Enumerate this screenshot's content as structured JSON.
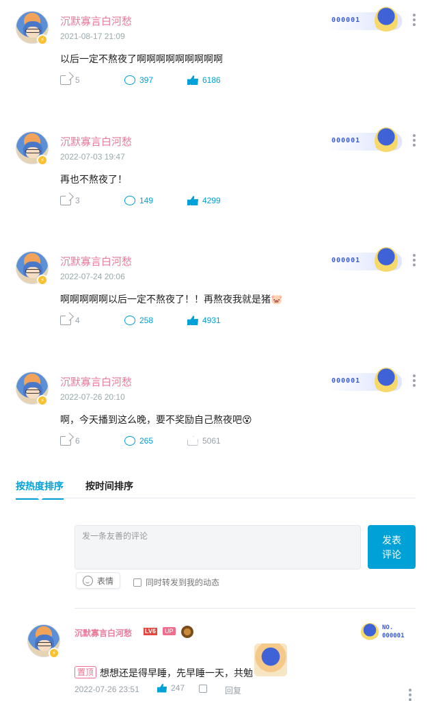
{
  "posts": [
    {
      "username": "沉默寡言白河愁",
      "date": "2021-08-17 21:09",
      "content": "以后一定不熬夜了啊啊啊啊啊啊啊啊啊",
      "shares": "5",
      "comments": "397",
      "likes": "6186",
      "fan_no": "000001"
    },
    {
      "username": "沉默寡言白河愁",
      "date": "2022-07-03 19:47",
      "content": "再也不熬夜了！",
      "shares": "3",
      "comments": "149",
      "likes": "4299",
      "fan_no": "000001"
    },
    {
      "username": "沉默寡言白河愁",
      "date": "2022-07-24 20:06",
      "content": "啊啊啊啊啊以后一定不熬夜了！！再熬夜我就是猪🐷",
      "shares": "4",
      "comments": "258",
      "likes": "4931",
      "fan_no": "000001"
    },
    {
      "username": "沉默寡言白河愁",
      "date": "2022-07-26 20:10",
      "content": "啊，今天播到这么晚，要不奖励自己熬夜吧😵",
      "shares": "6",
      "comments": "265",
      "likes": "5061",
      "fan_no": "000001"
    }
  ],
  "tabs": {
    "hot": "按热度排序",
    "time": "按时间排序"
  },
  "composer": {
    "placeholder": "发一条友善的评论",
    "send_line1": "发表",
    "send_line2": "评论",
    "emoji": "表情",
    "forward": "同时转发到我的动态"
  },
  "reply": {
    "username": "沉默寡言白河愁",
    "level": "LV6",
    "up_tag": "UP",
    "fan_label": "NO.",
    "fan_no": "000001",
    "pinned": "置顶",
    "text": "想想还是得早睡，先早睡一天，共勉",
    "date": "2022-07-26 23:51",
    "likes": "247",
    "reply_label": "回复"
  },
  "colors": {
    "accent": "#00a1d6",
    "username": "#e87a9a",
    "muted": "#99a2aa"
  }
}
